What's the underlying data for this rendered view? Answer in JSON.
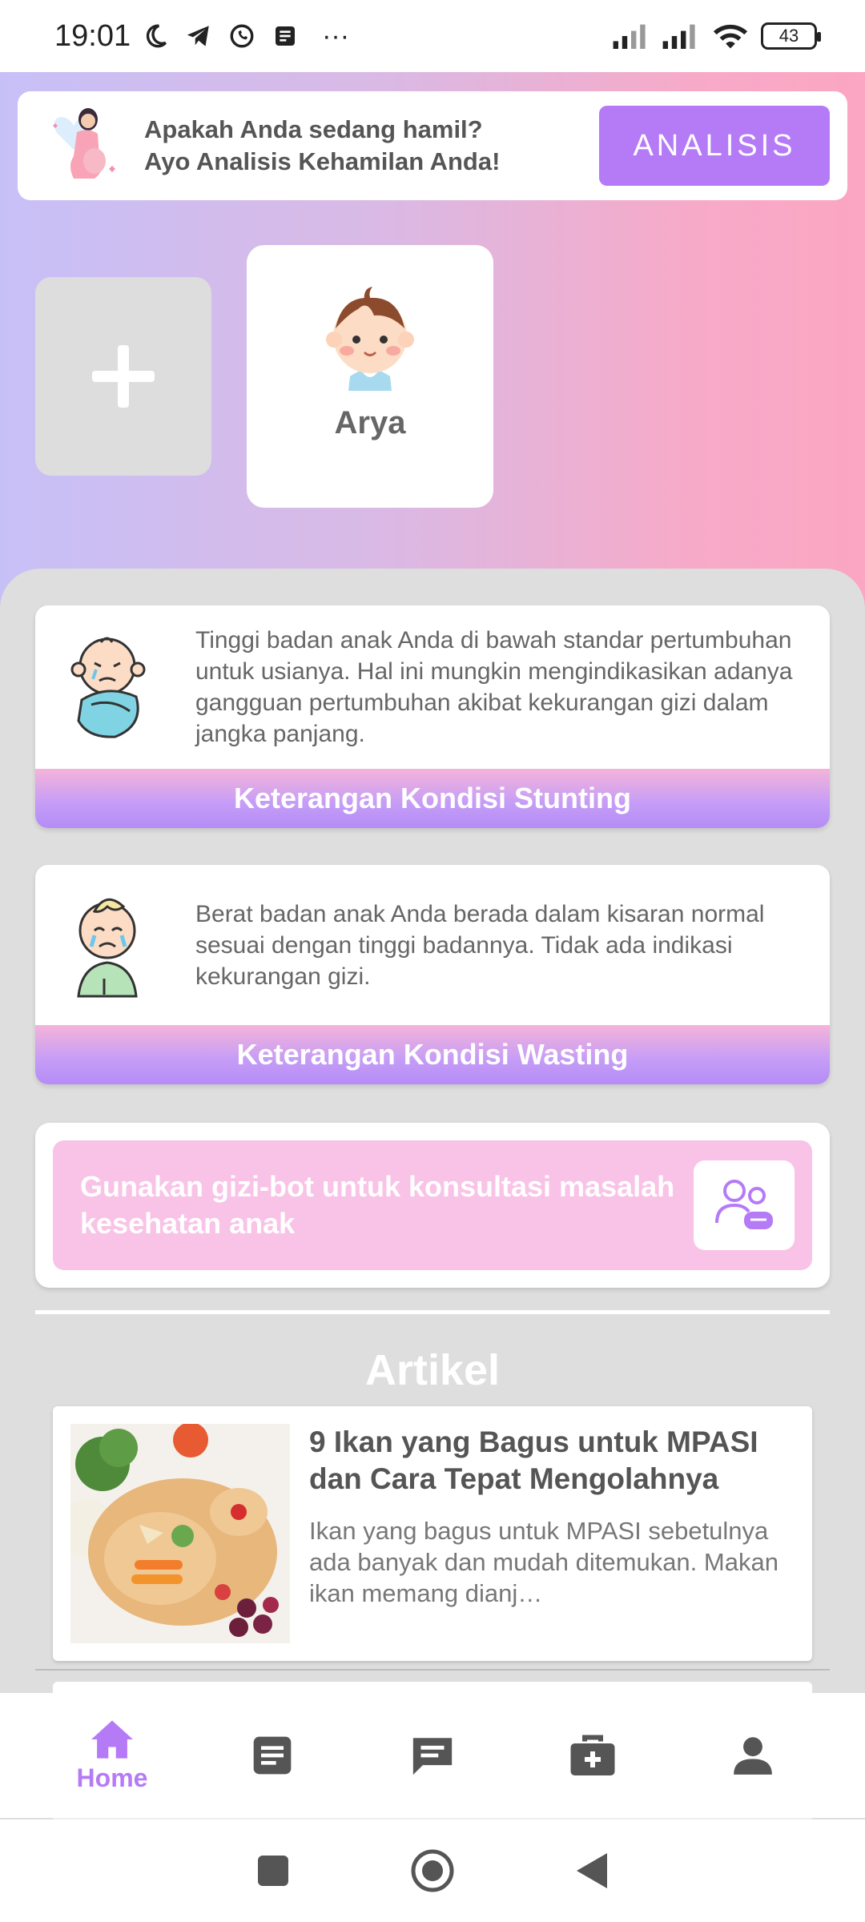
{
  "status_bar": {
    "time": "19:01",
    "more": "···",
    "battery": "43",
    "icons": [
      "moon-icon",
      "telegram-icon",
      "whatsapp-icon",
      "notes-icon",
      "signal-icon",
      "signal-icon",
      "wifi-icon",
      "battery-icon"
    ]
  },
  "promo": {
    "line1": "Apakah Anda sedang hamil?",
    "line2": "Ayo Analisis Kehamilan Anda!",
    "button_label": "ANALISIS"
  },
  "children": {
    "add_label": "+",
    "items": [
      {
        "name": "Arya"
      }
    ]
  },
  "conditions": [
    {
      "text": "Tinggi badan anak Anda di bawah standar pertumbuhan untuk usianya. Hal ini mungkin mengindikasikan adanya gangguan pertumbuhan akibat kekurangan gizi dalam jangka panjang.",
      "button": "Keterangan Kondisi Stunting"
    },
    {
      "text": "Berat badan anak Anda berada dalam kisaran normal sesuai dengan tinggi badannya. Tidak ada indikasi kekurangan gizi.",
      "button": "Keterangan Kondisi Wasting"
    }
  ],
  "bot": {
    "text": "Gunakan gizi-bot untuk konsultasi masalah kesehatan anak"
  },
  "articles_section": {
    "title": "Artikel",
    "items": [
      {
        "title": "9 Ikan yang Bagus untuk MPASI dan Cara Tepat Mengolahnya",
        "desc": "Ikan yang bagus untuk MPASI sebetulnya ada banyak dan mudah ditemukan. Makan ikan memang dianj…"
      }
    ]
  },
  "nav": {
    "items": [
      {
        "label": "Home",
        "icon": "home-icon",
        "active": true
      },
      {
        "label": "",
        "icon": "article-icon"
      },
      {
        "label": "",
        "icon": "chat-icon"
      },
      {
        "label": "",
        "icon": "medical-kit-icon"
      },
      {
        "label": "",
        "icon": "profile-icon"
      }
    ],
    "accent": "#b57bf7",
    "inactive": "#555555"
  }
}
